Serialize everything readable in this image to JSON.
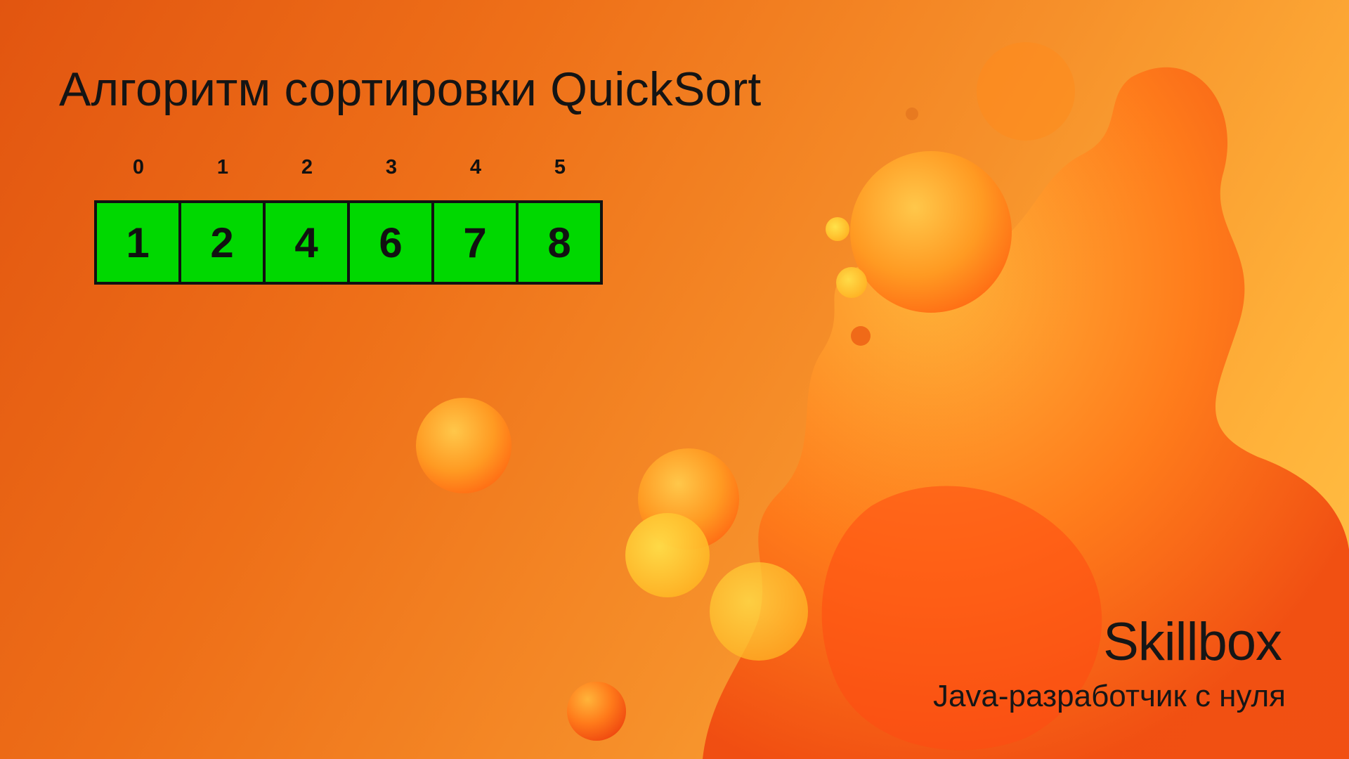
{
  "slide": {
    "title": "Алгоритм сортировки QuickSort"
  },
  "array": {
    "indices": [
      "0",
      "1",
      "2",
      "3",
      "4",
      "5"
    ],
    "values": [
      "1",
      "2",
      "4",
      "6",
      "7",
      "8"
    ],
    "cell_color": "#00d800"
  },
  "branding": {
    "logo": "Skillbox",
    "course": "Java-разработчик с нуля"
  }
}
